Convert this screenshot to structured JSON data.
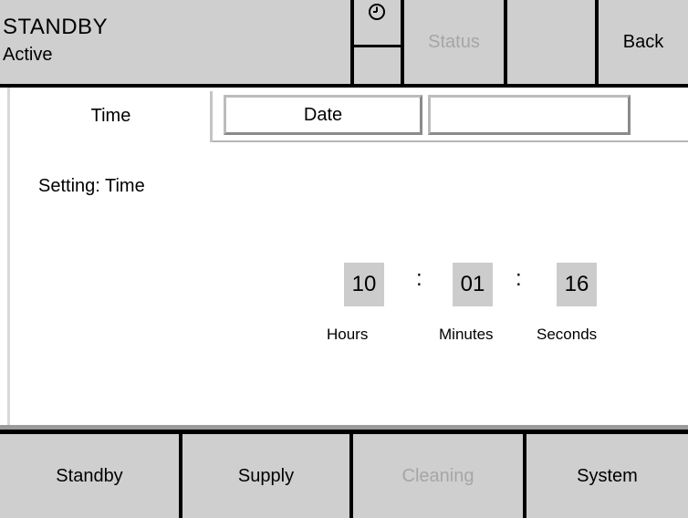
{
  "status": {
    "mode": "STANDBY",
    "state": "Active"
  },
  "header": {
    "clock_icon": "clock-icon",
    "status_label": "Status",
    "back_label": "Back"
  },
  "tabs": [
    {
      "label": "Time",
      "active": true
    },
    {
      "label": "Date",
      "active": false
    },
    {
      "label": "",
      "active": false
    }
  ],
  "setting": {
    "label": "Setting: Time"
  },
  "time": {
    "hours": "10",
    "minutes": "01",
    "seconds": "16",
    "separator": ":",
    "hours_label": "Hours",
    "minutes_label": "Minutes",
    "seconds_label": "Seconds"
  },
  "footer": [
    {
      "label": "Standby",
      "enabled": true
    },
    {
      "label": "Supply",
      "enabled": true
    },
    {
      "label": "Cleaning",
      "enabled": false
    },
    {
      "label": "System",
      "enabled": true
    }
  ],
  "colors": {
    "button_face": "#cfcfcf",
    "frame": "#000000",
    "panel": "#ffffff",
    "value_field": "#cccccc",
    "disabled_text": "#a6a6a6"
  }
}
